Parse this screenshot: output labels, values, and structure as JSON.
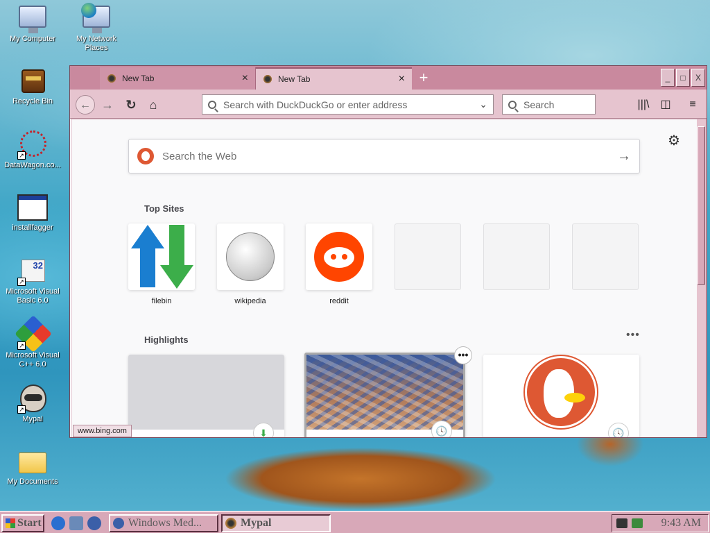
{
  "desktop": {
    "icons": [
      {
        "label": "My Computer"
      },
      {
        "label": "My Network Places"
      },
      {
        "label": "Recycle Bin"
      },
      {
        "label": "DataWagon.co..."
      },
      {
        "label": "installfagger"
      },
      {
        "label": "Microsoft Visual Basic 6.0",
        "badge": "32"
      },
      {
        "label": "Microsoft Visual C++ 6.0"
      },
      {
        "label": "Mypal"
      },
      {
        "label": "My Documents"
      }
    ]
  },
  "browser": {
    "tabs": [
      {
        "title": "New Tab",
        "close": "×"
      },
      {
        "title": "New Tab",
        "close": "×"
      }
    ],
    "new_tab": "+",
    "window_controls": {
      "minimize": "_",
      "maximize": "□",
      "close": "X"
    },
    "nav": {
      "back": "←",
      "forward": "→",
      "reload": "↻",
      "home": "⌂",
      "url_placeholder": "Search with DuckDuckGo or enter address",
      "url_dropdown": "⌄",
      "search_placeholder": "Search",
      "library": "|||\\",
      "sidebar": "◫",
      "menu": "≡"
    },
    "newtab": {
      "settings_icon": "⚙",
      "web_search_placeholder": "Search the Web",
      "web_search_go": "→",
      "top_sites_title": "Top Sites",
      "top_sites": [
        {
          "name": "filebin"
        },
        {
          "name": "wikipedia"
        },
        {
          "name": "reddit"
        },
        {
          "name": ""
        },
        {
          "name": ""
        },
        {
          "name": ""
        }
      ],
      "highlights_title": "Highlights",
      "highlights_more": "•••",
      "highlight_badges": [
        "⬇",
        "🕓",
        "🕓"
      ],
      "highlight_context": "•••"
    },
    "status_url": "www.bing.com"
  },
  "taskbar": {
    "start_label": "Start",
    "tasks": [
      {
        "label": "Windows Med..."
      },
      {
        "label": "Mypal"
      }
    ],
    "clock": "9:43 AM"
  }
}
